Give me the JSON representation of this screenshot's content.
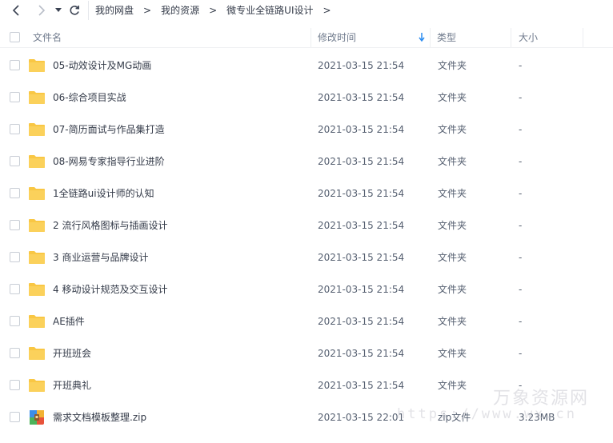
{
  "nav": {
    "back_icon": "chevron-left-icon",
    "forward_icon": "chevron-right-icon",
    "dropdown_icon": "caret-down-icon",
    "refresh_icon": "refresh-icon",
    "breadcrumb": [
      "我的网盘",
      "我的资源",
      "微专业全链路UI设计"
    ],
    "separator": ">"
  },
  "header": {
    "name": "文件名",
    "mtime": "修改时间",
    "type": "类型",
    "size": "大小",
    "sort_icon": "sort-down-arrow-icon"
  },
  "files": [
    {
      "name": "05-动效设计及MG动画",
      "mtime": "2021-03-15 21:54",
      "type": "文件夹",
      "size": "-",
      "icon": "folder-icon"
    },
    {
      "name": "06-综合项目实战",
      "mtime": "2021-03-15 21:54",
      "type": "文件夹",
      "size": "-",
      "icon": "folder-icon"
    },
    {
      "name": "07-简历面试与作品集打造",
      "mtime": "2021-03-15 21:54",
      "type": "文件夹",
      "size": "-",
      "icon": "folder-icon"
    },
    {
      "name": "08-网易专家指导行业进阶",
      "mtime": "2021-03-15 21:54",
      "type": "文件夹",
      "size": "-",
      "icon": "folder-icon"
    },
    {
      "name": "1全链路ui设计师的认知",
      "mtime": "2021-03-15 21:54",
      "type": "文件夹",
      "size": "-",
      "icon": "folder-icon"
    },
    {
      "name": "2 流行风格图标与插画设计",
      "mtime": "2021-03-15 21:54",
      "type": "文件夹",
      "size": "-",
      "icon": "folder-icon"
    },
    {
      "name": "3 商业运营与品牌设计",
      "mtime": "2021-03-15 21:54",
      "type": "文件夹",
      "size": "-",
      "icon": "folder-icon"
    },
    {
      "name": "4 移动设计规范及交互设计",
      "mtime": "2021-03-15 21:54",
      "type": "文件夹",
      "size": "-",
      "icon": "folder-icon"
    },
    {
      "name": "AE插件",
      "mtime": "2021-03-15 21:54",
      "type": "文件夹",
      "size": "-",
      "icon": "folder-icon"
    },
    {
      "name": "开班班会",
      "mtime": "2021-03-15 21:54",
      "type": "文件夹",
      "size": "-",
      "icon": "folder-icon"
    },
    {
      "name": "开班典礼",
      "mtime": "2021-03-15 21:54",
      "type": "文件夹",
      "size": "-",
      "icon": "folder-icon"
    },
    {
      "name": "需求文档模板整理.zip",
      "mtime": "2021-03-15 22:01",
      "type": "zip文件",
      "size": "3.23MB",
      "icon": "zip-archive-icon"
    }
  ],
  "watermark": {
    "text": "万象资源网",
    "url": "https://www.wx.cn"
  },
  "colors": {
    "folder": "#f9c744",
    "sort_arrow": "#2b8cf0",
    "text": "#333a48"
  }
}
